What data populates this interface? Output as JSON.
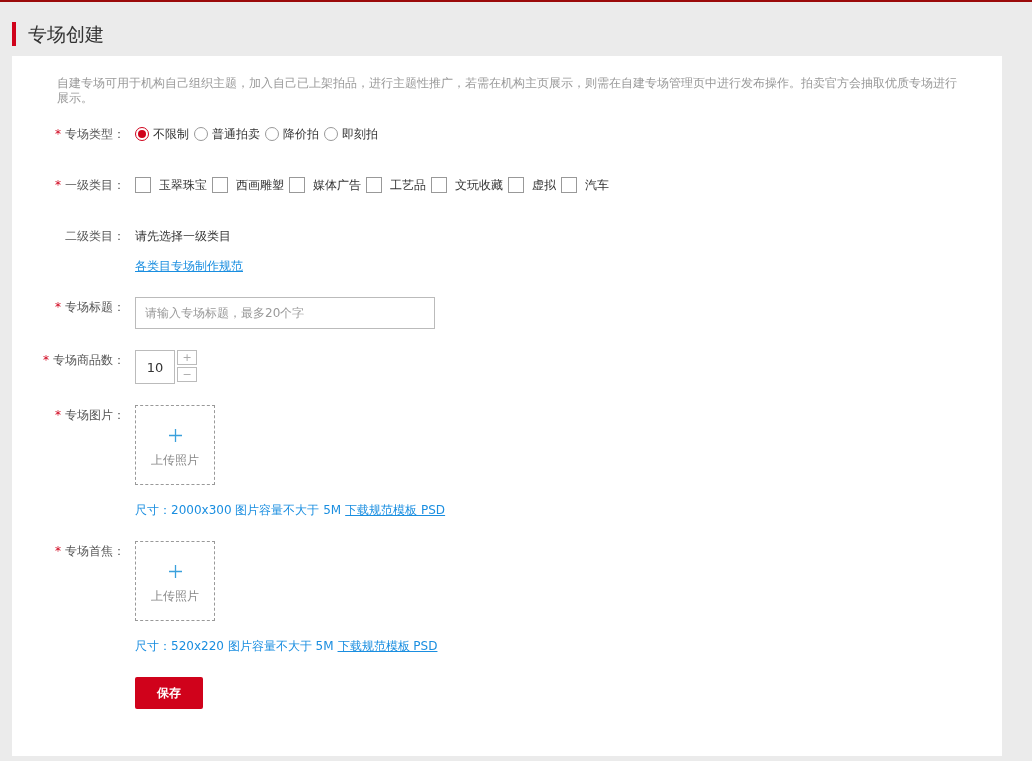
{
  "page_title": "专场创建",
  "description": "自建专场可用于机构自己组织主题，加入自己已上架拍品，进行主题性推广，若需在机构主页展示，则需在自建专场管理页中进行发布操作。拍卖官方会抽取优质专场进行展示。",
  "fields": [
    {
      "kind": "radio",
      "required_mark": "*",
      "label": "专场类型：",
      "options": [
        {
          "label": "不限制",
          "selected": true
        },
        {
          "label": "普通拍卖",
          "selected": false
        },
        {
          "label": "降价拍",
          "selected": false
        },
        {
          "label": "即刻拍",
          "selected": false
        }
      ]
    },
    {
      "kind": "checkbox",
      "required_mark": "*",
      "label": "一级类目：",
      "options": [
        {
          "label": "玉翠珠宝",
          "checked": false
        },
        {
          "label": "西画雕塑",
          "checked": false
        },
        {
          "label": "媒体广告",
          "checked": false
        },
        {
          "label": "工艺品",
          "checked": false
        },
        {
          "label": "文玩收藏",
          "checked": false
        },
        {
          "label": "虚拟",
          "checked": false
        },
        {
          "label": "汽车",
          "checked": false
        }
      ]
    },
    {
      "kind": "text",
      "label": "二级类目：",
      "value": "请先选择一级类目",
      "link": "各类目专场制作规范"
    },
    {
      "kind": "input",
      "required_mark": "*",
      "label": "专场标题：",
      "placeholder": "请输入专场标题，最多20个字"
    },
    {
      "kind": "number",
      "required_mark": "*",
      "label": "专场商品数：",
      "value": "10",
      "increment": "+",
      "decrement": "−"
    },
    {
      "kind": "upload",
      "required_mark": "*",
      "label": "专场图片：",
      "button_label": "上传照片",
      "hint": "尺寸：2000x300 图片容量不大于 5M",
      "hint_link": "下载规范模板 PSD"
    },
    {
      "kind": "upload",
      "required_mark": "*",
      "label": "专场首焦：",
      "button_label": "上传照片",
      "hint": "尺寸：520x220 图片容量不大于 5M",
      "hint_link": "下载规范模板 PSD"
    }
  ],
  "save_button": "保存"
}
